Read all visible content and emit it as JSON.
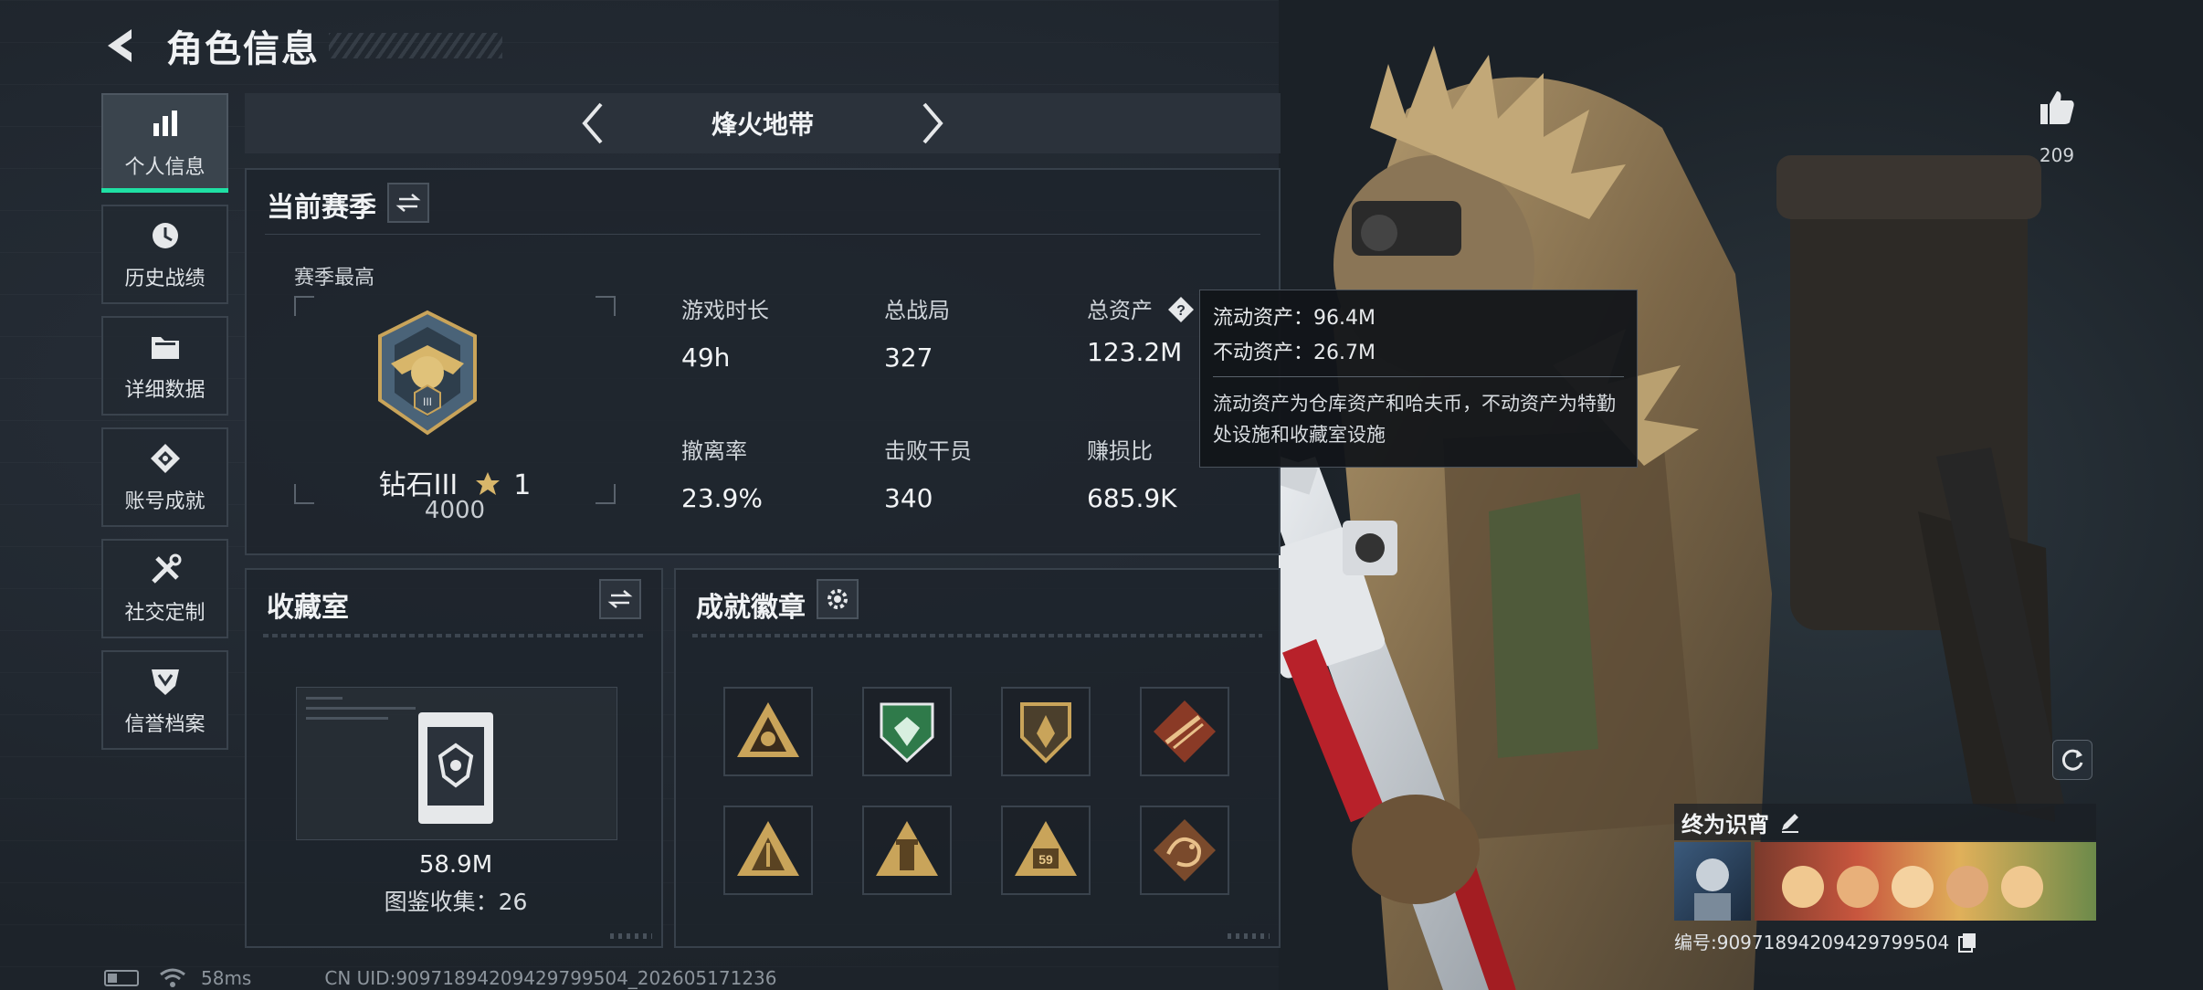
{
  "header": {
    "title": "角色信息"
  },
  "sidebar": {
    "items": [
      {
        "label": "个人信息",
        "icon": "bar-chart-icon",
        "active": true
      },
      {
        "label": "历史战绩",
        "icon": "history-clock-icon",
        "active": false
      },
      {
        "label": "详细数据",
        "icon": "folder-icon",
        "active": false
      },
      {
        "label": "账号成就",
        "icon": "achievement-icon",
        "active": false
      },
      {
        "label": "社交定制",
        "icon": "tools-icon",
        "active": false
      },
      {
        "label": "信誉档案",
        "icon": "shield-badge-icon",
        "active": false
      }
    ]
  },
  "map_switcher": {
    "name": "烽火地带"
  },
  "season": {
    "title": "当前赛季",
    "best_label": "赛季最高",
    "rank_name": "钻石III",
    "rank_stars": "1",
    "rank_score": "4000",
    "stats": [
      {
        "label": "游戏时长",
        "value": "49h"
      },
      {
        "label": "总战局",
        "value": "327"
      },
      {
        "label": "总资产",
        "value": "123.2M"
      },
      {
        "label": "撤离率",
        "value": "23.9%"
      },
      {
        "label": "击败干员",
        "value": "340"
      },
      {
        "label": "赚损比",
        "value": "685.9K"
      }
    ]
  },
  "tooltip": {
    "line1": "流动资产：96.4M",
    "line2": "不动资产：26.7M",
    "description": "流动资产为仓库资产和哈夫币，不动资产为特勤处设施和收藏室设施"
  },
  "collection": {
    "title": "收藏室",
    "value": "58.9M",
    "count_text": "图鉴收集：26"
  },
  "badges": {
    "title": "成就徽章",
    "items": [
      "badge-triangle-helmet-icon",
      "badge-green-shield-icon",
      "badge-gold-shield-icon",
      "badge-diamond-weapon-icon",
      "badge-triangle-gold-icon",
      "badge-triangle-tower-icon",
      "badge-triangle-59-icon",
      "badge-diamond-dragon-icon"
    ],
    "badge_59_text": "59"
  },
  "profile": {
    "likes": "209",
    "nickname": "终为识宵",
    "uid_text": "编号:90971894209429799504"
  },
  "status_bar": {
    "ping": "58ms",
    "uid_line": "CN UID:90971894209429799504_202605171236"
  },
  "colors": {
    "accent": "#1fe0a4",
    "panel_border": "#38414b",
    "background": "#1f252d",
    "gold": "#c9a45a"
  }
}
